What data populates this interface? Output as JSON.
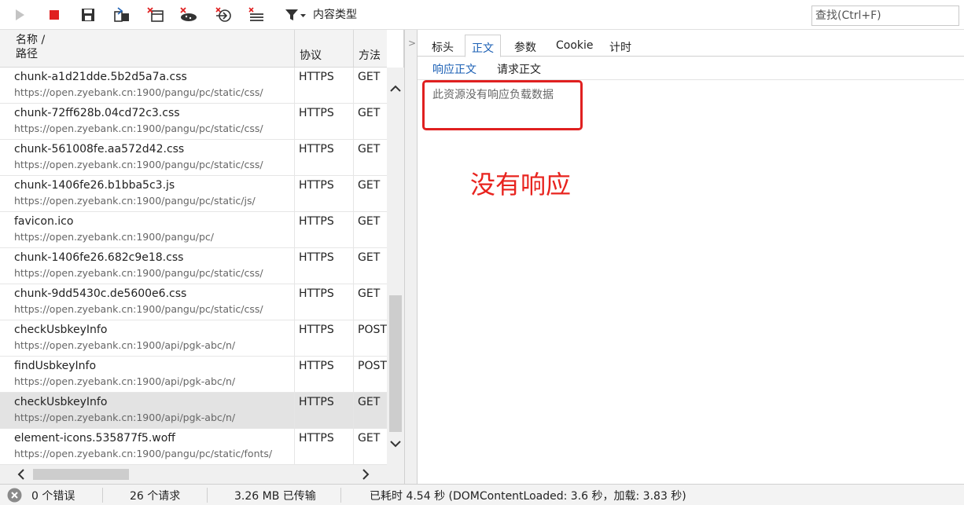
{
  "toolbar": {
    "content_type_label": "内容类型",
    "search_placeholder": "查找(Ctrl+F)"
  },
  "list": {
    "header": {
      "name_line1": "名称 /",
      "name_line2": "路径",
      "protocol": "协议",
      "method": "方法"
    },
    "rows": [
      {
        "name": "chunk-a1d21dde.5b2d5a7a.css",
        "path": "https://open.zyebank.cn:1900/pangu/pc/static/css/",
        "protocol": "HTTPS",
        "method": "GET"
      },
      {
        "name": "chunk-72ff628b.04cd72c3.css",
        "path": "https://open.zyebank.cn:1900/pangu/pc/static/css/",
        "protocol": "HTTPS",
        "method": "GET"
      },
      {
        "name": "chunk-561008fe.aa572d42.css",
        "path": "https://open.zyebank.cn:1900/pangu/pc/static/css/",
        "protocol": "HTTPS",
        "method": "GET"
      },
      {
        "name": "chunk-1406fe26.b1bba5c3.js",
        "path": "https://open.zyebank.cn:1900/pangu/pc/static/js/",
        "protocol": "HTTPS",
        "method": "GET"
      },
      {
        "name": "favicon.ico",
        "path": "https://open.zyebank.cn:1900/pangu/pc/",
        "protocol": "HTTPS",
        "method": "GET"
      },
      {
        "name": "chunk-1406fe26.682c9e18.css",
        "path": "https://open.zyebank.cn:1900/pangu/pc/static/css/",
        "protocol": "HTTPS",
        "method": "GET"
      },
      {
        "name": "chunk-9dd5430c.de5600e6.css",
        "path": "https://open.zyebank.cn:1900/pangu/pc/static/css/",
        "protocol": "HTTPS",
        "method": "GET"
      },
      {
        "name": "checkUsbkeyInfo",
        "path": "https://open.zyebank.cn:1900/api/pgk-abc/n/",
        "protocol": "HTTPS",
        "method": "POST"
      },
      {
        "name": "findUsbkeyInfo",
        "path": "https://open.zyebank.cn:1900/api/pgk-abc/n/",
        "protocol": "HTTPS",
        "method": "POST"
      },
      {
        "name": "checkUsbkeyInfo",
        "path": "https://open.zyebank.cn:1900/api/pgk-abc/n/",
        "protocol": "HTTPS",
        "method": "GET"
      },
      {
        "name": "element-icons.535877f5.woff",
        "path": "https://open.zyebank.cn:1900/pangu/pc/static/fonts/",
        "protocol": "HTTPS",
        "method": "GET"
      }
    ]
  },
  "detail": {
    "tabs": [
      "标头",
      "正文",
      "参数",
      "Cookie",
      "计时"
    ],
    "active_tab": "正文",
    "subtabs": [
      "响应正文",
      "请求正文"
    ],
    "active_subtab": "响应正文",
    "message": "此资源没有响应负载数据",
    "annotation": "没有响应"
  },
  "status": {
    "errors": "0 个错误",
    "requests": "26 个请求",
    "transferred": "3.26 MB 已传输",
    "timing": "已耗时 4.54 秒 (DOMContentLoaded: 3.6 秒，加载: 3.83 秒)"
  },
  "colors": {
    "accent": "#1a5fb4",
    "stop_red": "#e02020",
    "annotation_red": "#e8231e"
  }
}
